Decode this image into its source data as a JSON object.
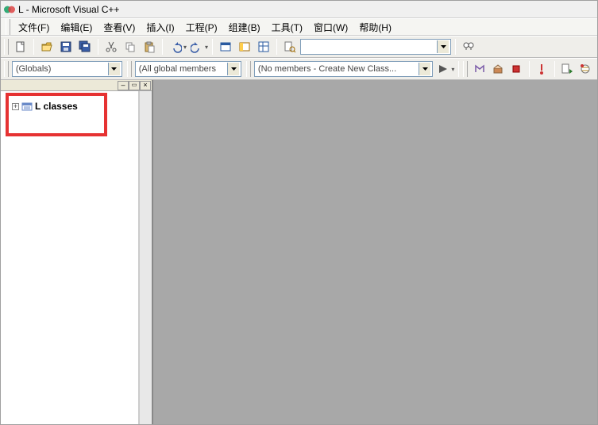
{
  "title": "L - Microsoft Visual C++",
  "menu": {
    "file": "文件(F)",
    "edit": "编辑(E)",
    "view": "查看(V)",
    "insert": "插入(I)",
    "project": "工程(P)",
    "build": "组建(B)",
    "tools": "工具(T)",
    "window": "窗口(W)",
    "help": "帮助(H)"
  },
  "combos": {
    "config_label": "(Globals)",
    "members_label": "(All global members",
    "create_label": "(No members - Create New Class...",
    "find_value": ""
  },
  "tree": {
    "root_label": "L classes"
  },
  "icons": {
    "app": "vc-icon",
    "new": "new-file-icon",
    "open": "open-icon",
    "save": "save-icon",
    "saveall": "save-all-icon",
    "cut": "cut-icon",
    "copy": "copy-icon",
    "paste": "paste-icon",
    "undo": "undo-icon",
    "redo": "redo-icon",
    "wnd1": "window-list-icon",
    "wnd2": "window-tile-icon",
    "wnd3": "window-cascade-icon",
    "find": "find-icon",
    "binoc": "find-in-files-icon",
    "wizard": "wizard-icon",
    "cls1": "class-add-icon",
    "cls2": "class-wizard-icon",
    "cls3": "class-view-icon",
    "excl": "breakpoint-icon",
    "dbg1": "step-into-icon",
    "dbg2": "step-over-icon"
  }
}
